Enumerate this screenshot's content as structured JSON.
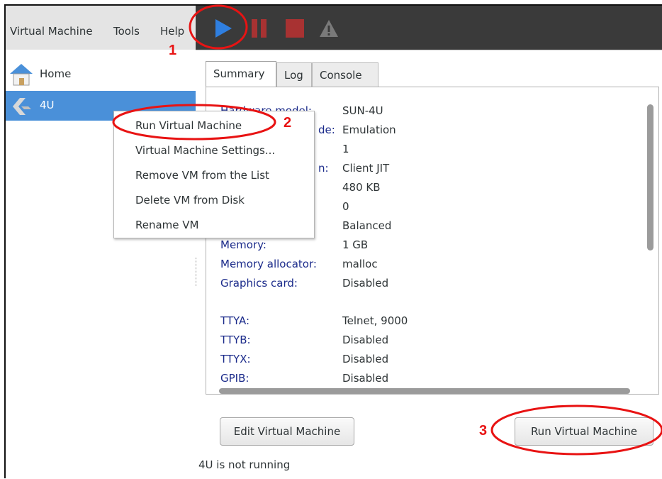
{
  "menubar": {
    "items": [
      "Virtual Machine",
      "Tools",
      "Help"
    ]
  },
  "toolbar": {
    "icons": [
      "play-icon",
      "pause-icon",
      "stop-icon",
      "warning-icon"
    ],
    "colors": {
      "play": "#2f7fe0",
      "pause": "#a83232",
      "stop": "#a83232",
      "warning": "#7a7a7a"
    }
  },
  "sidebar": {
    "items": [
      {
        "label": "Home",
        "icon": "home-icon"
      },
      {
        "label": "4U",
        "icon": "vm-logo-icon"
      }
    ],
    "selected_color": "#4a90d9"
  },
  "tabs": [
    "Summary",
    "Log",
    "Console"
  ],
  "summary": {
    "rows": [
      {
        "label": "Hardware model:",
        "value": "SUN-4U"
      },
      {
        "label": "de:",
        "value": "Emulation"
      },
      {
        "label": "",
        "value": "1"
      },
      {
        "label": "n:",
        "value": "Client JIT"
      },
      {
        "label": "",
        "value": "480 KB"
      },
      {
        "label": "",
        "value": "0"
      },
      {
        "label": "",
        "value": "Balanced"
      },
      {
        "label": "Memory:",
        "value": "1 GB"
      },
      {
        "label": "Memory allocator:",
        "value": "malloc"
      },
      {
        "label": "Graphics card:",
        "value": "Disabled"
      }
    ],
    "ports": [
      {
        "label": "TTYA:",
        "value": "Telnet, 9000"
      },
      {
        "label": "TTYB:",
        "value": "Disabled"
      },
      {
        "label": "TTYX:",
        "value": "Disabled"
      },
      {
        "label": "GPIB:",
        "value": "Disabled"
      }
    ]
  },
  "context_menu": {
    "items": [
      "Run Virtual Machine",
      "Virtual Machine Settings...",
      "Remove VM from the List",
      "Delete VM from Disk",
      "Rename VM"
    ]
  },
  "buttons": {
    "edit": "Edit Virtual Machine",
    "run": "Run Virtual Machine"
  },
  "status": "4U is not running",
  "annotations": {
    "labels": [
      "1",
      "2",
      "3"
    ],
    "color": "#e81313"
  }
}
